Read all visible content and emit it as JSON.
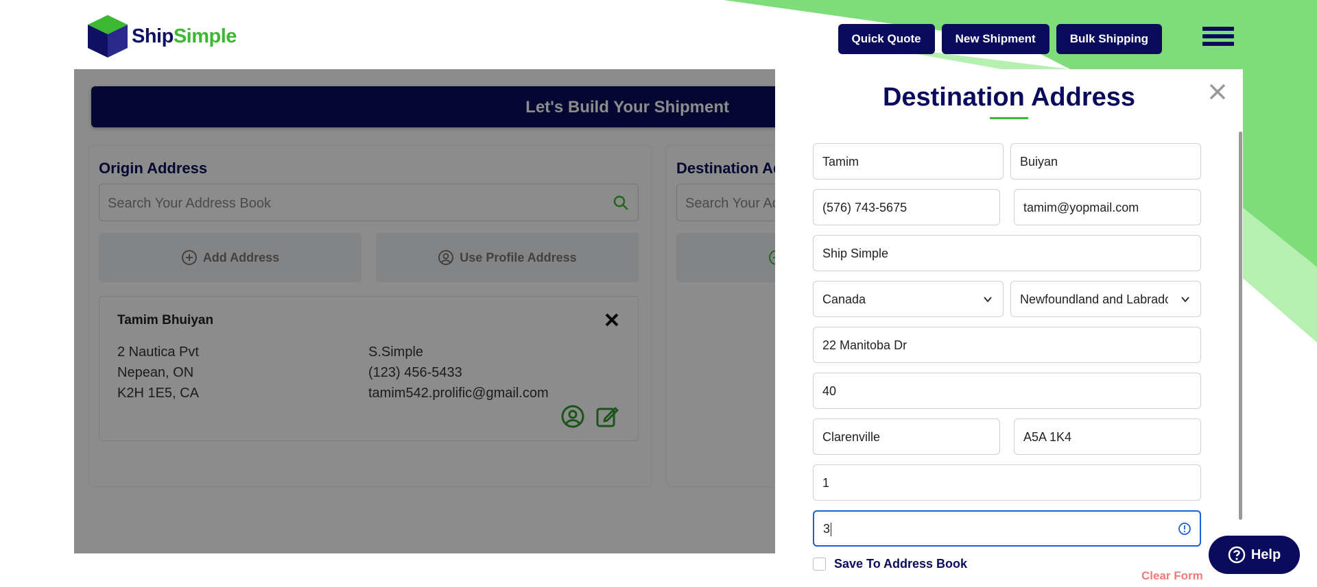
{
  "brand": {
    "name_part1": "Ship",
    "name_part2": "Simple"
  },
  "header": {
    "buttons": [
      "Quick Quote",
      "New Shipment",
      "Bulk Shipping"
    ],
    "menu_icon": "hamburger-icon"
  },
  "banner": {
    "title": "Let's Build Your Shipment"
  },
  "origin": {
    "title": "Origin Address",
    "search_placeholder": "Search Your Address Book",
    "add_address": "Add Address",
    "use_profile": "Use Profile Address",
    "card": {
      "name": "Tamim Bhuiyan",
      "line1": "2 Nautica Pvt",
      "line2": "Nepean, ON",
      "line3": "K2H 1E5, CA",
      "company": "S.Simple",
      "phone": "(123) 456-5433",
      "email": "tamim542.prolific@gmail.com"
    }
  },
  "destination_card": {
    "title": "Destination Ad",
    "search_placeholder": "Search Your Ad"
  },
  "drawer": {
    "title": "Destination Address",
    "fields": {
      "first_name": "Tamim",
      "last_name": "Buiyan",
      "phone": "(576) 743-5675",
      "email": "tamim@yopmail.com",
      "company": "Ship Simple",
      "country": "Canada",
      "province": "Newfoundland and Labrador",
      "street": "22 Manitoba Dr",
      "unit": "40",
      "city": "Clarenville",
      "postal": "A5A 1K4",
      "field_a": "1",
      "field_b": "3"
    },
    "save_label": "Save To Address Book",
    "clear_form": "Clear Form"
  },
  "help": {
    "label": "Help"
  },
  "colors": {
    "navy": "#0a0b5c",
    "green": "#3cb832",
    "clear_red": "#f07a7a",
    "focus_blue": "#1b5fd1"
  }
}
